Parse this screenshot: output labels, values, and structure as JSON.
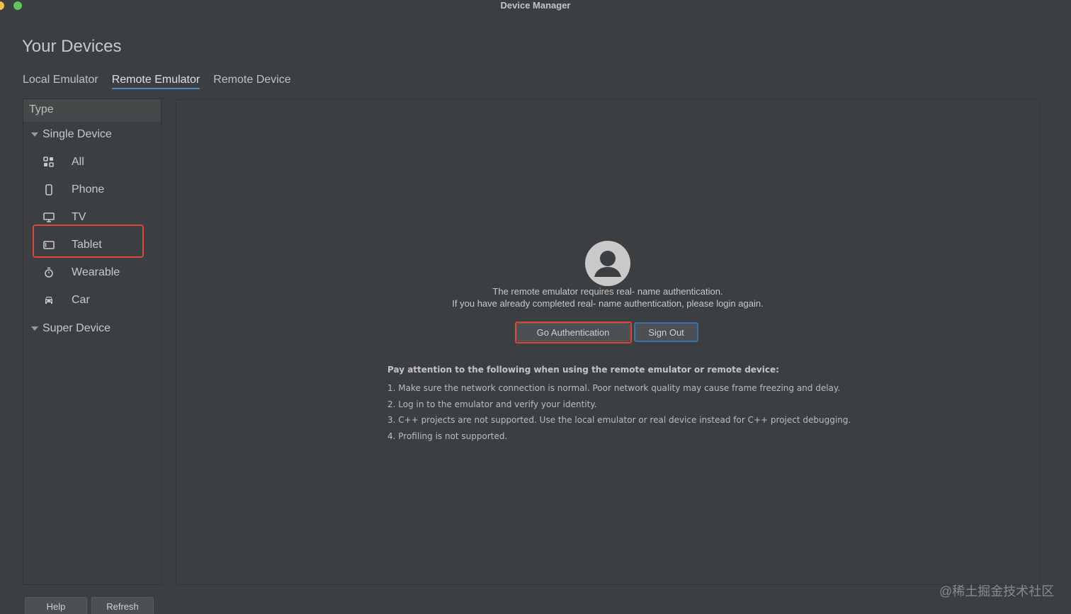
{
  "window": {
    "title": "Device Manager"
  },
  "page": {
    "title": "Your Devices"
  },
  "tabs": [
    {
      "label": "Local Emulator",
      "active": false
    },
    {
      "label": "Remote Emulator",
      "active": true
    },
    {
      "label": "Remote Device",
      "active": false
    }
  ],
  "sidebar": {
    "header": "Type",
    "groups": [
      {
        "label": "Single Device",
        "expanded": true
      },
      {
        "label": "Super Device",
        "expanded": true
      }
    ],
    "items": [
      {
        "label": "All",
        "icon": "grid-icon"
      },
      {
        "label": "Phone",
        "icon": "phone-icon"
      },
      {
        "label": "TV",
        "icon": "tv-icon"
      },
      {
        "label": "Tablet",
        "icon": "tablet-icon"
      },
      {
        "label": "Wearable",
        "icon": "watch-icon"
      },
      {
        "label": "Car",
        "icon": "car-icon"
      }
    ]
  },
  "auth": {
    "line1": "The remote emulator requires real- name authentication.",
    "line2": "If you have already completed real- name authentication, please login again.",
    "go_button": "Go Authentication",
    "signout_button": "Sign Out"
  },
  "notes": {
    "title": "Pay attention to the following when using the remote emulator or remote device:",
    "items": [
      "1. Make sure the network connection is normal. Poor network quality may cause frame freezing and delay.",
      "2. Log in to the emulator and verify your identity.",
      "3. C++ projects are not supported. Use the local emulator or real device instead for C++ project debugging.",
      "4. Profiling is not supported."
    ]
  },
  "footer": {
    "help": "Help",
    "refresh": "Refresh"
  },
  "watermark": "@稀土掘金技术社区",
  "colors": {
    "accent": "#4a88c7",
    "highlight": "#e0453a",
    "background": "#3c3f41"
  }
}
